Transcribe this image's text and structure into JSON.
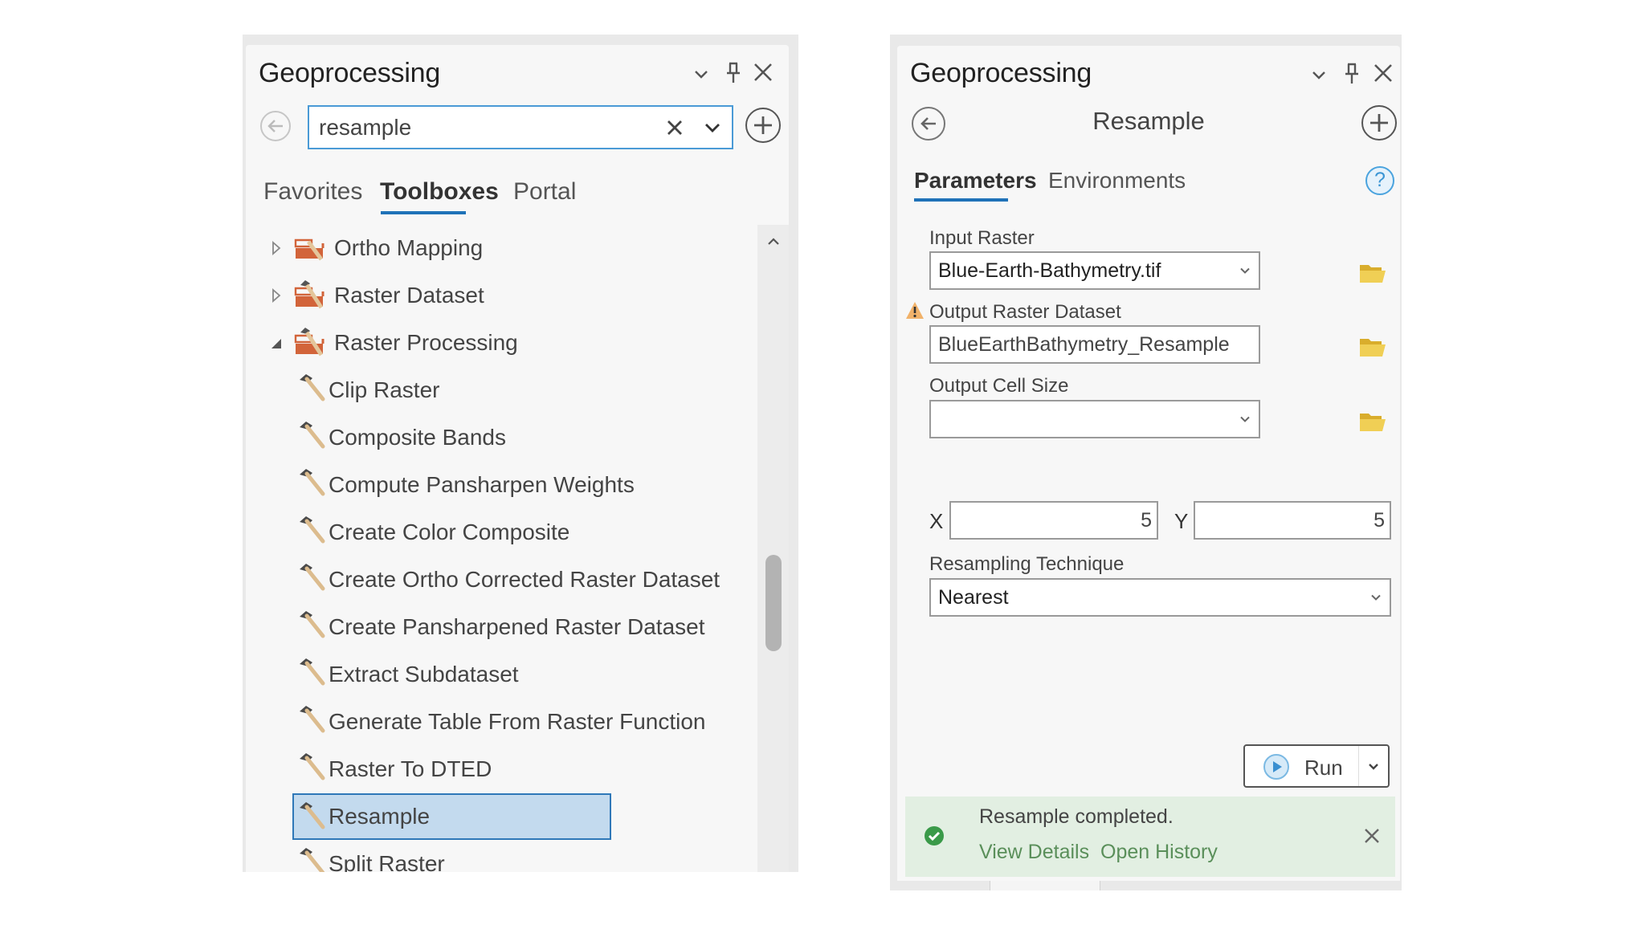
{
  "left_panel": {
    "title": "Geoprocessing",
    "header_icons": [
      "chevron-down-icon",
      "pin-icon",
      "close-icon"
    ],
    "search": {
      "value": "resample",
      "placeholder": "",
      "clear_icon": "clear-icon",
      "dropdown_icon": "chevron-down-icon"
    },
    "back_icon": "back-arrow-icon",
    "add_icon": "add-circle-icon",
    "tabs": [
      {
        "label": "Favorites",
        "active": false
      },
      {
        "label": "Toolboxes",
        "active": true
      },
      {
        "label": "Portal",
        "active": false
      }
    ],
    "toolsets": [
      {
        "label": "Ortho Mapping",
        "expanded": false
      },
      {
        "label": "Raster Dataset",
        "expanded": false
      },
      {
        "label": "Raster Processing",
        "expanded": true
      }
    ],
    "tools": [
      {
        "label": "Clip Raster",
        "selected": false
      },
      {
        "label": "Composite Bands",
        "selected": false
      },
      {
        "label": "Compute Pansharpen Weights",
        "selected": false
      },
      {
        "label": "Create Color Composite",
        "selected": false
      },
      {
        "label": "Create Ortho Corrected Raster Dataset",
        "selected": false
      },
      {
        "label": "Create Pansharpened Raster Dataset",
        "selected": false
      },
      {
        "label": "Extract Subdataset",
        "selected": false
      },
      {
        "label": "Generate Table From Raster Function",
        "selected": false
      },
      {
        "label": "Raster To DTED",
        "selected": false
      },
      {
        "label": "Resample",
        "selected": true
      },
      {
        "label": "Split Raster",
        "selected": false
      }
    ]
  },
  "right_panel": {
    "title": "Geoprocessing",
    "tool_name": "Resample",
    "tabs": [
      {
        "label": "Parameters",
        "active": true
      },
      {
        "label": "Environments",
        "active": false
      }
    ],
    "help_icon": "help-icon",
    "params": {
      "input_raster": {
        "label": "Input Raster",
        "value": "Blue-Earth-Bathymetry.tif"
      },
      "output_raster": {
        "label": "Output Raster Dataset",
        "value": "BlueEarthBathymetry_Resample",
        "warning": true
      },
      "cell_size": {
        "label": "Output Cell Size",
        "value": "",
        "x_label": "X",
        "x_value": "5",
        "y_label": "Y",
        "y_value": "5"
      },
      "technique": {
        "label": "Resampling Technique",
        "value": "Nearest"
      }
    },
    "run_button": {
      "label": "Run"
    },
    "status": {
      "message": "Resample completed.",
      "links": [
        "View Details",
        "Open History"
      ]
    }
  },
  "colors": {
    "accent": "#1f72b8",
    "selection": "#c3daee",
    "success_bg": "#e2efe2",
    "success_icon": "#3a9a49",
    "link": "#5a8f5a",
    "folder": "#e8c34a",
    "warning": "#f0a640"
  }
}
